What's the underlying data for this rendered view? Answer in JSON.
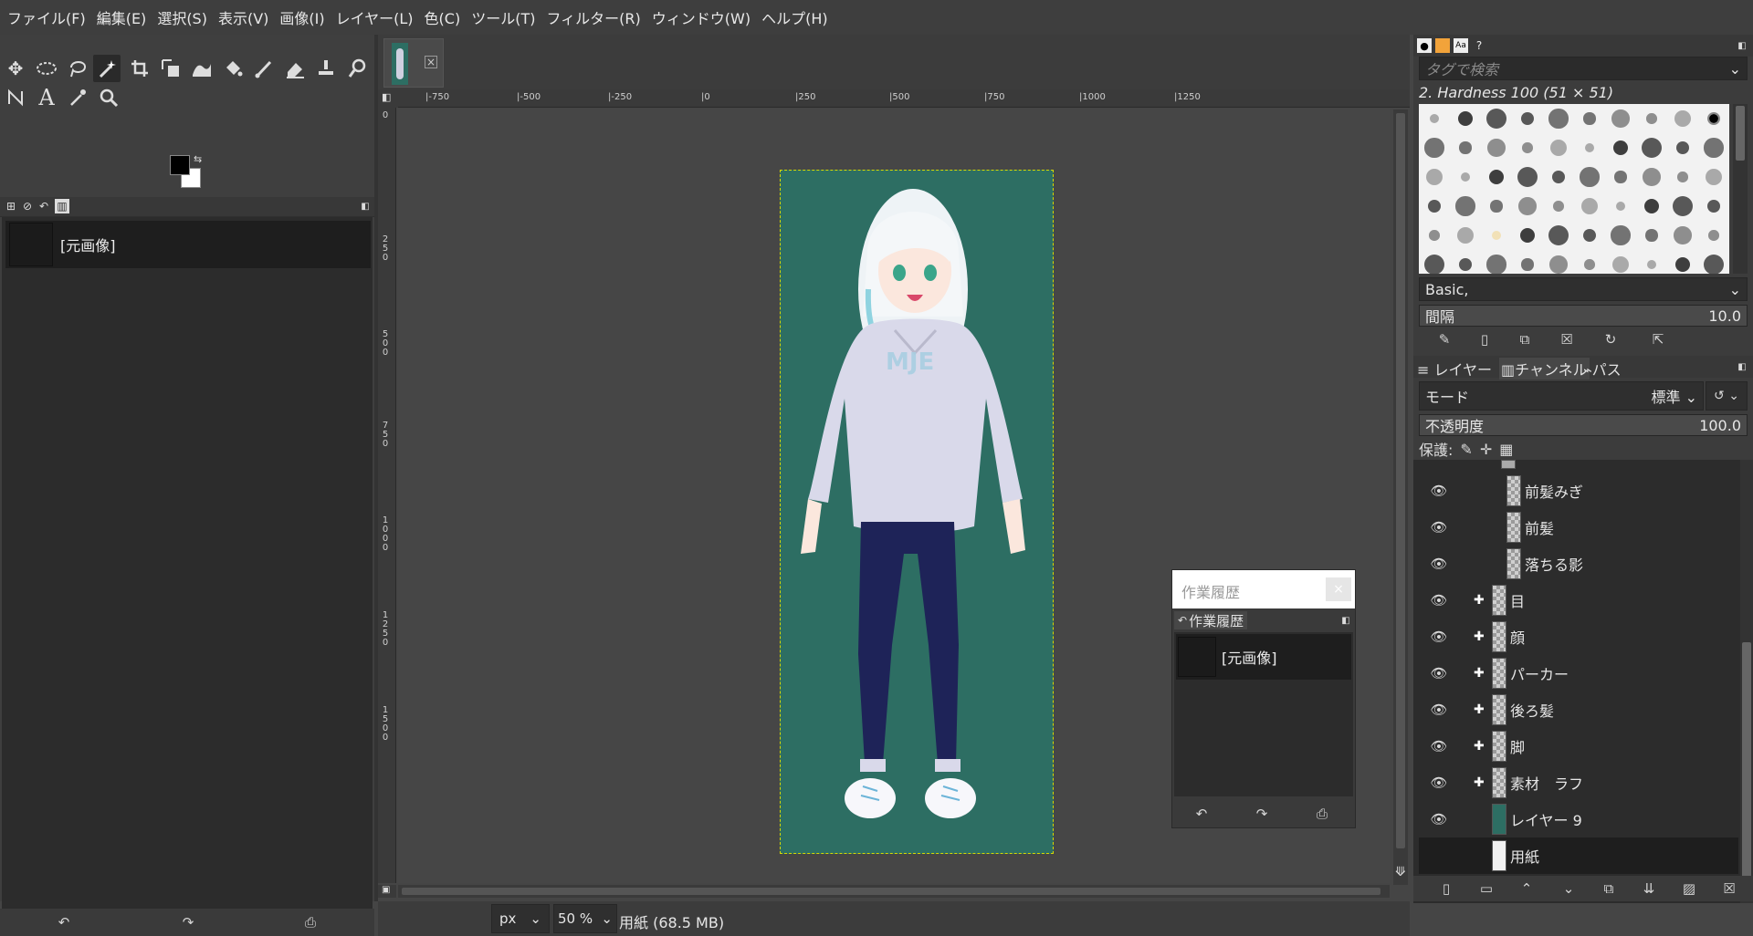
{
  "menubar": {
    "items": [
      "ファイル(F)",
      "編集(E)",
      "選択(S)",
      "表示(V)",
      "画像(I)",
      "レイヤー(L)",
      "色(C)",
      "ツール(T)",
      "フィルター(R)",
      "ウィンドウ(W)",
      "ヘルプ(H)"
    ]
  },
  "toolbox": {
    "row1": [
      "move-tool-icon",
      "ellipse-select-icon",
      "free-select-icon",
      "fuzzy-select-icon",
      "crop-icon",
      "unified-transform-icon",
      "warp-transform-icon",
      "bucket-fill-icon",
      "paintbrush-icon",
      "eraser-icon",
      "clone-icon",
      "smudge-icon"
    ],
    "row2": [
      "paths-icon",
      "text-tool-icon",
      "color-picker-icon",
      "zoom-tool-icon"
    ],
    "fg_color": "#000000",
    "bg_color": "#ffffff"
  },
  "images_panel": {
    "item_label": "[元画像]"
  },
  "canvas": {
    "hruler_labels": [
      "-750",
      "-500",
      "-250",
      "0",
      "250",
      "500",
      "750",
      "1000",
      "1250"
    ],
    "vruler_labels": [
      "0",
      "250",
      "500",
      "750",
      "1000",
      "1250",
      "1500"
    ],
    "page_color": "#2d6e63"
  },
  "status": {
    "unit": "px",
    "zoom": "50 %",
    "info": "用紙 (68.5 MB)"
  },
  "history_float": {
    "window_title": "作業履歴",
    "tab_label": "作業履歴",
    "item_label": "[元画像]"
  },
  "brushes": {
    "search_placeholder": "タグで検索",
    "brush_name": "2. Hardness 100 (51 × 51)",
    "preset": "Basic,",
    "spacing_label": "間隔",
    "spacing_value": "10.0"
  },
  "layers_panel": {
    "tabs": [
      "レイヤー",
      "チャンネル",
      "パス"
    ],
    "mode_label": "モード",
    "mode_value": "標準",
    "opacity_label": "不透明度",
    "opacity_value": "100.0",
    "lock_label": "保護:",
    "layers": [
      {
        "name": "前髪みぎ",
        "group": false,
        "indent": 2
      },
      {
        "name": "前髪",
        "group": false,
        "indent": 2
      },
      {
        "name": "落ちる影",
        "group": false,
        "indent": 2
      },
      {
        "name": "目",
        "group": true,
        "indent": 1
      },
      {
        "name": "顔",
        "group": true,
        "indent": 1
      },
      {
        "name": "パーカー",
        "group": true,
        "indent": 1
      },
      {
        "name": "後ろ髪",
        "group": true,
        "indent": 1
      },
      {
        "name": "脚",
        "group": true,
        "indent": 1
      },
      {
        "name": "素材　ラフ",
        "group": true,
        "indent": 1
      },
      {
        "name": "レイヤー 9",
        "group": false,
        "indent": 1
      },
      {
        "name": "用紙",
        "group": false,
        "indent": 1
      }
    ]
  }
}
